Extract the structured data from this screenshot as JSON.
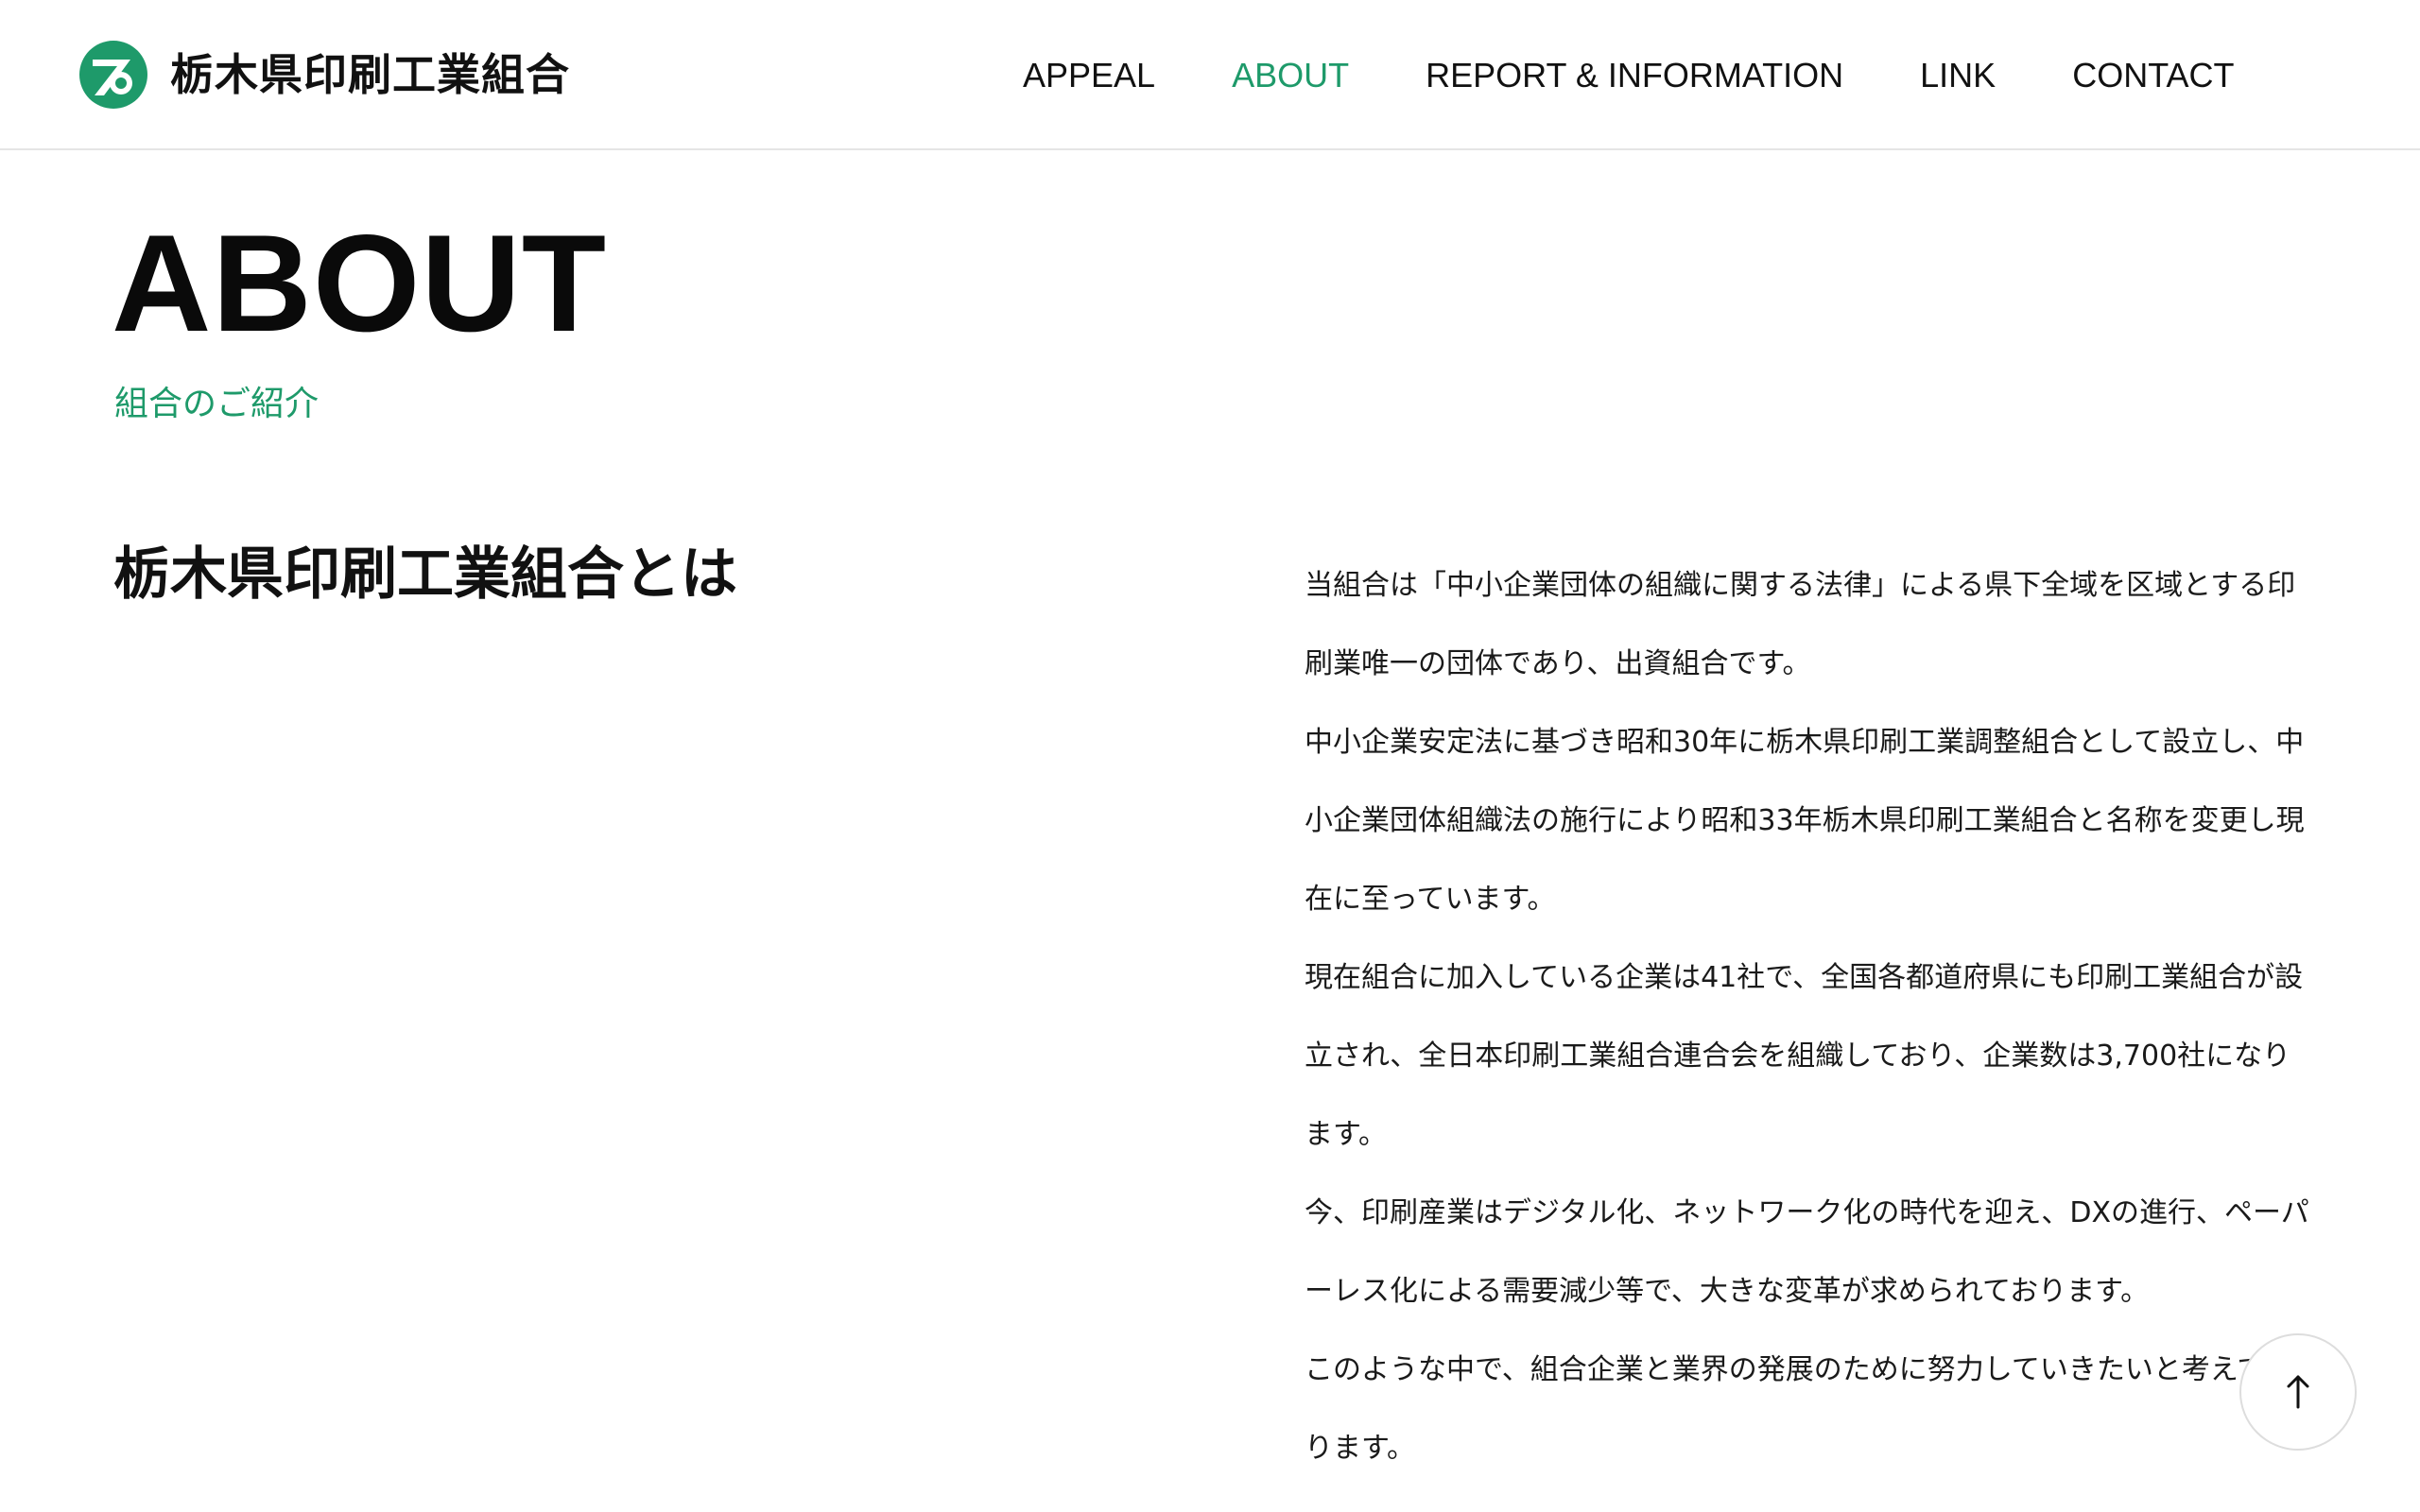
{
  "header": {
    "brand_name": "栃木県印刷工業組合",
    "logo_icon": "union-logo-icon",
    "nav": [
      {
        "label": "APPEAL",
        "active": false
      },
      {
        "label": "ABOUT",
        "active": true
      },
      {
        "label": "REPORT & INFORMATION",
        "active": false
      },
      {
        "label": "LINK",
        "active": false
      },
      {
        "label": "CONTACT",
        "active": false
      }
    ]
  },
  "hero": {
    "title": "ABOUT",
    "subtitle": "組合のご紹介"
  },
  "section": {
    "title": "栃木県印刷工業組合とは",
    "paragraphs": [
      "当組合は「中小企業団体の組織に関する法律」による県下全域を区域とする印刷業唯一の団体であり、出資組合です。",
      "中小企業安定法に基づき昭和30年に栃木県印刷工業調整組合として設立し、中小企業団体組織法の施行により昭和33年栃木県印刷工業組合と名称を変更し現在に至っています。",
      "現在組合に加入している企業は41社で、全国各都道府県にも印刷工業組合が設立され、全日本印刷工業組合連合会を組織しており、企業数は3,700社になります。",
      "今、印刷産業はデジタル化、ネットワーク化の時代を迎え、DXの進行、ペーパーレス化による需要減少等で、大きな変革が求められております。",
      "このような中で、組合企業と業界の発展のために努力していきたいと考えております。"
    ]
  },
  "scroll_top": {
    "icon": "arrow-up-icon"
  },
  "colors": {
    "accent": "#1e9a6a",
    "text": "#111111",
    "border": "#e5e5e5"
  }
}
